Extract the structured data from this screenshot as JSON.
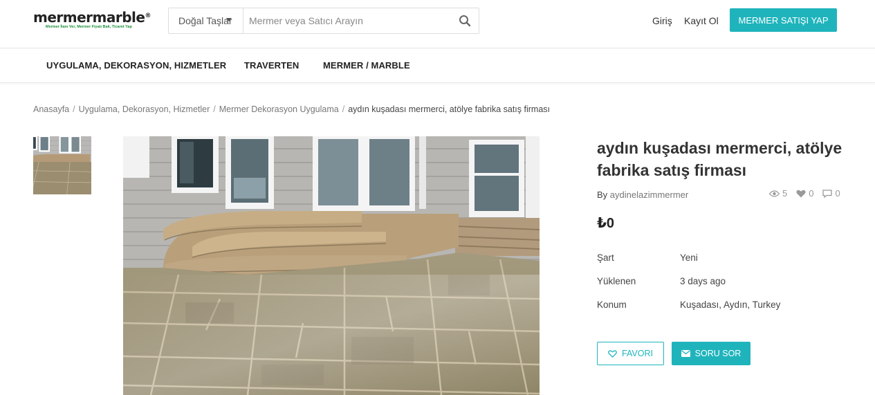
{
  "brand": {
    "logo_text": "mermermarble",
    "logo_mark": "®",
    "tagline": "Mermer İlanı Ver, Mermer Fiyatı Bak, Ticaret Yap"
  },
  "header": {
    "search": {
      "category": "Doğal Taşlar",
      "placeholder": "Mermer veya Satıcı Arayın",
      "icon": "search-icon"
    },
    "login": "Giriş",
    "register": "Kayıt Ol",
    "sell_button": "MERMER SATIŞI YAP"
  },
  "categories": [
    "UYGULAMA, DEKORASYON, HIZMETLER",
    "TRAVERTEN",
    "MERMER / MARBLE"
  ],
  "breadcrumb": [
    "Anasayfa",
    "Uygulama, Dekorasyon, Hizmetler",
    "Mermer Dekorasyon Uygulama",
    "aydın kuşadası mermerci, atölye fabrika satış firması"
  ],
  "listing": {
    "title": "aydın kuşadası mermerci, atölye fabrika satış firması",
    "by_label": "By",
    "seller": "aydinelazimmermer",
    "views": "5",
    "likes": "0",
    "comments": "0",
    "price": "₺0",
    "specs": [
      {
        "label": "Şart",
        "value": "Yeni"
      },
      {
        "label": "Yüklenen",
        "value": "3 days ago"
      },
      {
        "label": "Konum",
        "value": "Kuşadası, Aydın, Turkey"
      }
    ],
    "favorite_button": "FAVORI",
    "ask_button": "SORU SOR"
  },
  "colors": {
    "accent": "#1fb4bc",
    "logo_green": "#1a8f3a"
  }
}
